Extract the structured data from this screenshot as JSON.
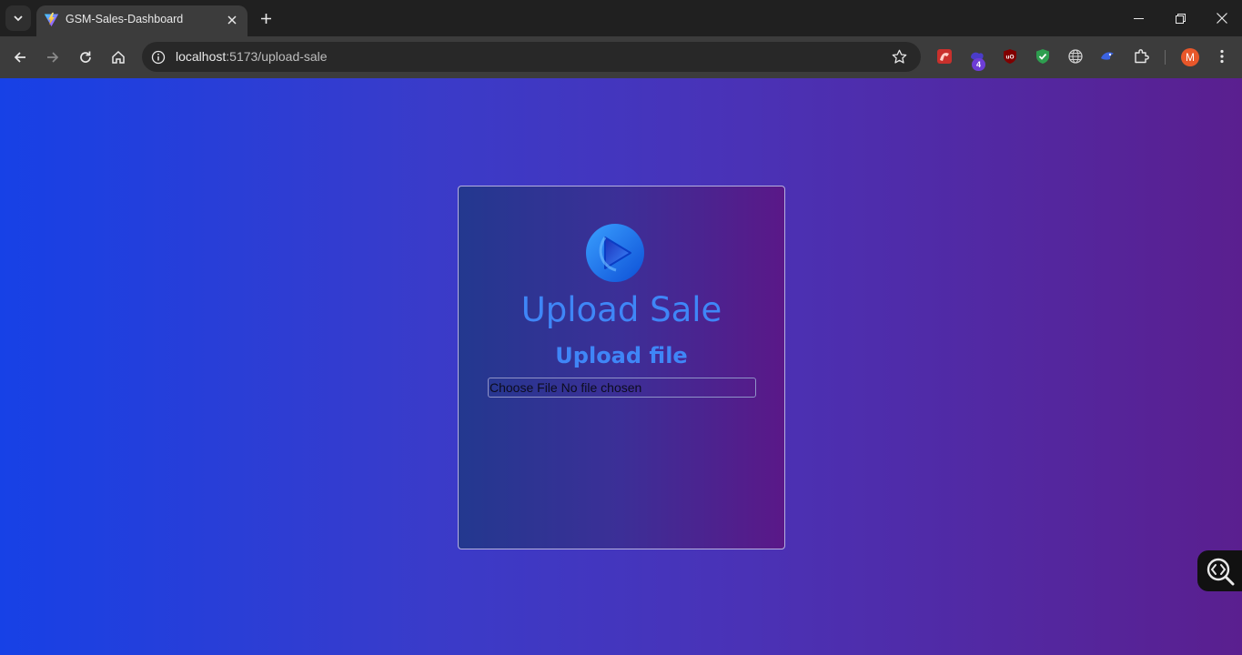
{
  "browser": {
    "tab": {
      "title": "GSM-Sales-Dashboard",
      "favicon": "vite-icon"
    },
    "new_tab_icon": "plus-icon",
    "window_controls": [
      "minimize-icon",
      "restore-icon",
      "close-icon"
    ],
    "address": {
      "host": "localhost",
      "rest": ":5173/upload-sale"
    },
    "extensions": [
      "ext-red-icon",
      "ext-purple-icon",
      "ublock-icon",
      "shield-check-icon",
      "globe-icon",
      "ext-bird-icon",
      "puzzle-icon"
    ],
    "extension_badge": "4",
    "profile_initial": "M"
  },
  "page": {
    "title": "Upload Sale",
    "subtitle": "Upload file",
    "file_input": {
      "button_label": "Choose File",
      "status": "No file chosen"
    }
  },
  "colors": {
    "accent": "#3f86f7",
    "page_gradient_start": "#1741e6",
    "page_gradient_end": "#5a1f8f"
  }
}
